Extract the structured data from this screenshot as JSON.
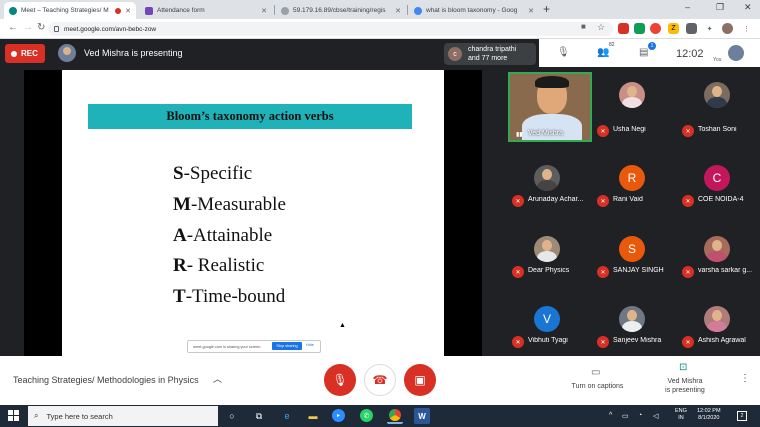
{
  "browser": {
    "tabs": [
      {
        "title": "Meet – Teaching Strategies/ M",
        "favicon_color": "#00897b",
        "recording": true
      },
      {
        "title": "Attendance form",
        "favicon_color": "#7248b9"
      },
      {
        "title": "59.179.16.89/cbse/training/regis",
        "favicon_color": "#9aa0a6"
      },
      {
        "title": "what is bloom taxonomy - Goog",
        "favicon_color": "#4285f4"
      }
    ],
    "new_tab": "+",
    "url": "meet.google.com/avn-bebc-zow",
    "window_controls": [
      "–",
      "❐",
      "✕"
    ]
  },
  "meet_header": {
    "rec_label": "REC",
    "presenting_text": "Ved Mishra is presenting",
    "attendee_initial": "c",
    "attendee_line1": "chandra tripathi",
    "attendee_line2": "and 77 more",
    "participants_count": "82",
    "chat_badge": "1",
    "clock": "12:02",
    "you_label": "You"
  },
  "slide": {
    "title": "Bloom’s taxonomy action verbs",
    "lines": [
      {
        "letter": "S",
        "rest": "-Specific"
      },
      {
        "letter": "M",
        "rest": "-Measurable"
      },
      {
        "letter": "A",
        "rest": "-Attainable"
      },
      {
        "letter": "R",
        "rest": "- Realistic"
      },
      {
        "letter": "T",
        "rest": "-Time-bound"
      }
    ],
    "share_text": "meet.google.com is sharing your screen.",
    "stop_label": "Stop sharing",
    "hide_label": "Hide"
  },
  "participants": [
    {
      "name": "Ved Mishra",
      "video": true
    },
    {
      "name": "Usha Negi",
      "avatar": "photo",
      "color": "#c98f86"
    },
    {
      "name": "Toshan Soni",
      "avatar": "photo",
      "color": "#7a6d5f"
    },
    {
      "name": "Arunaday Achar...",
      "avatar": "photo",
      "color": "#5d5d5d"
    },
    {
      "name": "Rani Vaid",
      "avatar": "R",
      "color": "#e8590c"
    },
    {
      "name": "COE NOIDA-4",
      "avatar": "C",
      "color": "#c2185b"
    },
    {
      "name": "Dear Physics",
      "avatar": "photo",
      "color": "#9e8a78"
    },
    {
      "name": "SANJAY SINGH",
      "avatar": "S",
      "color": "#e8590c"
    },
    {
      "name": "varsha sarkar g...",
      "avatar": "photo",
      "color": "#a66b5b"
    },
    {
      "name": "Vibhuti Tyagi",
      "avatar": "V",
      "color": "#1976d2"
    },
    {
      "name": "Sanjeev Mishra",
      "avatar": "photo",
      "color": "#6f7782"
    },
    {
      "name": "Ashish Agrawal",
      "avatar": "photo",
      "color": "#b07b7b"
    }
  ],
  "controls": {
    "meeting_title": "Teaching Strategies/ Methodologies in Physics",
    "captions_label": "Turn on captions",
    "presenting_line1": "Ved Mishra",
    "presenting_line2": "is presenting"
  },
  "taskbar": {
    "search_placeholder": "Type here to search",
    "lang_line1": "ENG",
    "lang_line2": "IN",
    "time": "12:02 PM",
    "date": "8/1/2020",
    "notifications": "2"
  }
}
